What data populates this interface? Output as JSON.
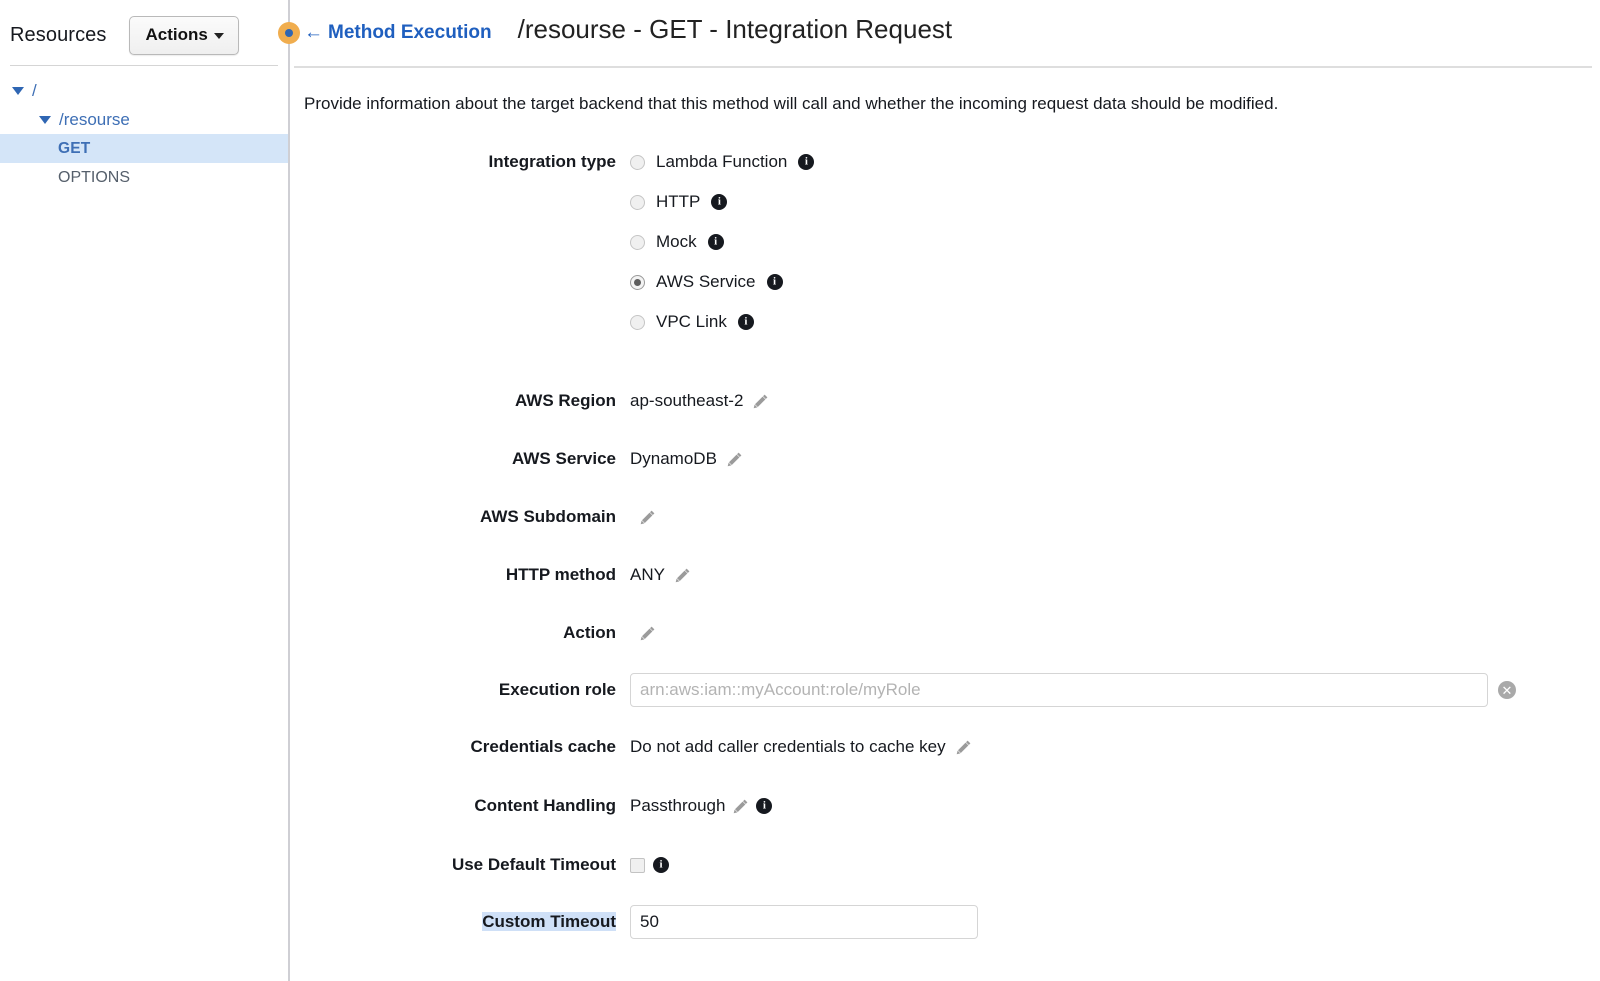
{
  "sidebar": {
    "title": "Resources",
    "actions_button": "Actions",
    "tree": [
      {
        "label": "/",
        "type": "root",
        "expanded": true,
        "selected": false
      },
      {
        "label": "/resourse",
        "type": "resource",
        "expanded": true,
        "selected": false
      },
      {
        "label": "GET",
        "type": "method",
        "expanded": false,
        "selected": true
      },
      {
        "label": "OPTIONS",
        "type": "method",
        "expanded": false,
        "selected": false
      }
    ]
  },
  "header": {
    "back_link": "Method Execution",
    "back_arrow": "←",
    "title": "/resourse - GET - Integration Request"
  },
  "main": {
    "description": "Provide information about the target backend that this method will call and whether the incoming request data should be modified."
  },
  "form": {
    "integration_type": {
      "label": "Integration type",
      "selected": "AWS Service",
      "options": [
        {
          "label": "Lambda Function",
          "checked": false,
          "info": true
        },
        {
          "label": "HTTP",
          "checked": false,
          "info": true
        },
        {
          "label": "Mock",
          "checked": false,
          "info": true
        },
        {
          "label": "AWS Service",
          "checked": true,
          "info": true
        },
        {
          "label": "VPC Link",
          "checked": false,
          "info": true
        }
      ]
    },
    "aws_region": {
      "label": "AWS Region",
      "value": "ap-southeast-2"
    },
    "aws_service": {
      "label": "AWS Service",
      "value": "DynamoDB"
    },
    "aws_subdomain": {
      "label": "AWS Subdomain",
      "value": ""
    },
    "http_method": {
      "label": "HTTP method",
      "value": "ANY"
    },
    "action": {
      "label": "Action",
      "value": ""
    },
    "execution_role": {
      "label": "Execution role",
      "value": "",
      "placeholder": "arn:aws:iam::myAccount:role/myRole"
    },
    "credentials_cache": {
      "label": "Credentials cache",
      "value": "Do not add caller credentials to cache key"
    },
    "content_handling": {
      "label": "Content Handling",
      "value": "Passthrough"
    },
    "use_default_timeout": {
      "label": "Use Default Timeout",
      "checked": false
    },
    "custom_timeout": {
      "label": "Custom Timeout",
      "value": "50",
      "highlighted": true
    }
  },
  "icons": {
    "info": "i",
    "clear": "✕",
    "pencil": "pencil-icon"
  },
  "colors": {
    "link": "#1f5fbf",
    "tree_link": "#3e6fb5",
    "selection": "#d4e5f8",
    "handle_orange": "#f0ad4e",
    "handle_dot": "#2f66b3"
  }
}
